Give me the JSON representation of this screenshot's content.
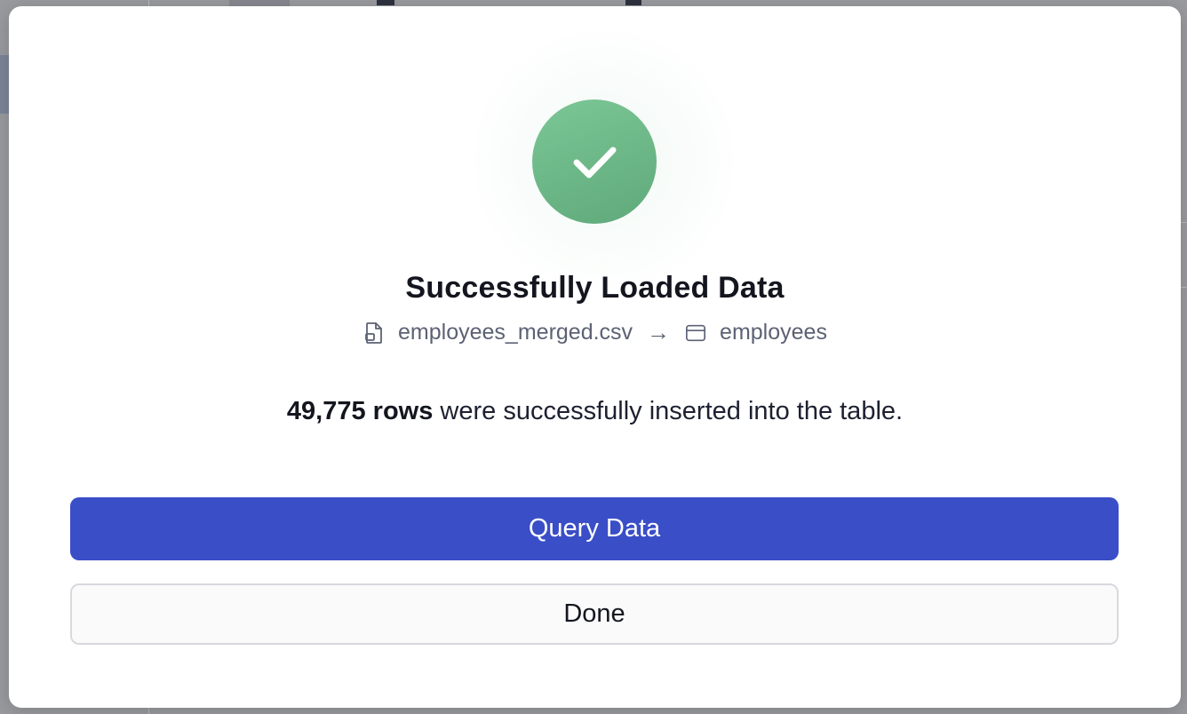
{
  "modal": {
    "title": "Successfully Loaded Data",
    "source_file": "employees_merged.csv",
    "arrow": "→",
    "target_table": "employees",
    "rows_count": "49,775 rows",
    "rows_message": " were successfully inserted into the table.",
    "primary_button_label": "Query Data",
    "secondary_button_label": "Done"
  },
  "icons": {
    "status": "check-icon",
    "source": "file-icon",
    "target": "table-icon"
  },
  "colors": {
    "success": "#6bb886",
    "primary": "#3a4ec7",
    "text": "#14161f",
    "muted": "#5c6275"
  }
}
